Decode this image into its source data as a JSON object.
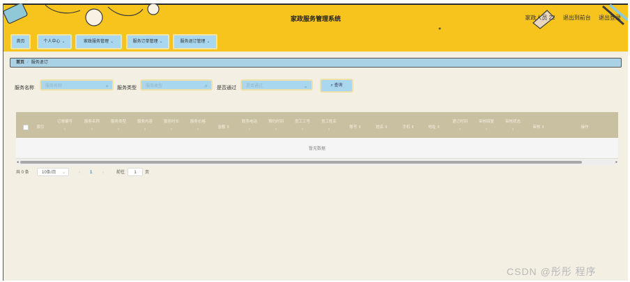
{
  "header": {
    "title": "家政服务管理系统",
    "user_label": "家政人员 22",
    "exit_front": "退出到前台",
    "logout": "退出登录"
  },
  "nav": {
    "items": [
      {
        "label": "首页",
        "has_dropdown": false
      },
      {
        "label": "个人中心",
        "has_dropdown": true
      },
      {
        "label": "家政服务管理",
        "has_dropdown": true
      },
      {
        "label": "服务订单管理",
        "has_dropdown": true
      },
      {
        "label": "服务退订管理",
        "has_dropdown": true
      }
    ]
  },
  "breadcrumb": {
    "home": "首页",
    "separator": "/",
    "current": "服务退订"
  },
  "search": {
    "service_name_label": "服务名称",
    "service_name_placeholder": "服务名称",
    "service_type_label": "服务类型",
    "service_type_placeholder": "服务类型",
    "passed_label": "是否通过",
    "passed_placeholder": "是否通过",
    "query_button": "查询",
    "search_icon": "search-icon",
    "dropdown_icon": "chevron-down-icon"
  },
  "table": {
    "columns": [
      {
        "label": "索引"
      },
      {
        "label": "订单编号"
      },
      {
        "label": "服务名称"
      },
      {
        "label": "服务类型"
      },
      {
        "label": "服务内容"
      },
      {
        "label": "服务时长"
      },
      {
        "label": "服务价格"
      },
      {
        "label": "金额"
      },
      {
        "label": "联系电话"
      },
      {
        "label": "预约时间"
      },
      {
        "label": "员工工号"
      },
      {
        "label": "员工姓名"
      },
      {
        "label": "账号"
      },
      {
        "label": "姓名"
      },
      {
        "label": "手机"
      },
      {
        "label": "地址"
      },
      {
        "label": "退订时间"
      },
      {
        "label": "审核回复"
      },
      {
        "label": "审核状态"
      },
      {
        "label": "审核"
      },
      {
        "label": "操作"
      }
    ],
    "empty_text": "暂无数据"
  },
  "pagination": {
    "total": "共 0 条",
    "page_size": "10条/页",
    "prev": "‹",
    "current_page": "1",
    "next": "›",
    "goto_label": "前往",
    "goto_value": "1",
    "page_unit": "页"
  },
  "watermark": "CSDN @彤彤  程序",
  "colors": {
    "header_bg": "#f6c41c",
    "page_bg": "#f3f0e3",
    "button_bg": "#a9d7ef",
    "table_header_bg": "#c9bfa1"
  }
}
